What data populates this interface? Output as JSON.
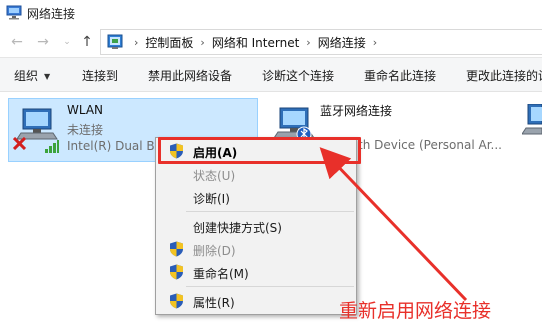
{
  "window": {
    "title": "网络连接"
  },
  "nav": {
    "back_icon": "arrow-left-icon",
    "forward_icon": "arrow-right-icon",
    "recent_icon": "chevron-down-icon",
    "up_icon": "arrow-up-icon"
  },
  "breadcrumb": {
    "items": [
      "控制面板",
      "网络和 Internet",
      "网络连接"
    ]
  },
  "toolbar": {
    "organize": "组织",
    "connect_to": "连接到",
    "disable": "禁用此网络设备",
    "diagnose": "诊断这个连接",
    "rename": "重命名此连接",
    "change_settings": "更改此连接的设"
  },
  "adapters": [
    {
      "name": "WLAN",
      "status": "未连接",
      "device": "Intel(R) Dual Ba"
    },
    {
      "name": "蓝牙网络连接",
      "status": "",
      "device": "th Device (Personal Ar..."
    }
  ],
  "context_menu": {
    "items": [
      {
        "label": "启用(A)",
        "shield": true,
        "bold": true,
        "disabled": false
      },
      {
        "label": "状态(U)",
        "shield": false,
        "bold": false,
        "disabled": true
      },
      {
        "label": "诊断(I)",
        "shield": false,
        "bold": false,
        "disabled": false
      },
      {
        "label": "创建快捷方式(S)",
        "shield": false,
        "bold": false,
        "disabled": false
      },
      {
        "label": "删除(D)",
        "shield": true,
        "bold": false,
        "disabled": true
      },
      {
        "label": "重命名(M)",
        "shield": true,
        "bold": false,
        "disabled": false
      },
      {
        "label": "属性(R)",
        "shield": true,
        "bold": false,
        "disabled": false
      }
    ]
  },
  "annotation": {
    "text": "重新启用网络连接",
    "color": "#e8302a"
  },
  "colors": {
    "selection": "#cce8ff",
    "accent_red": "#e8302a"
  }
}
